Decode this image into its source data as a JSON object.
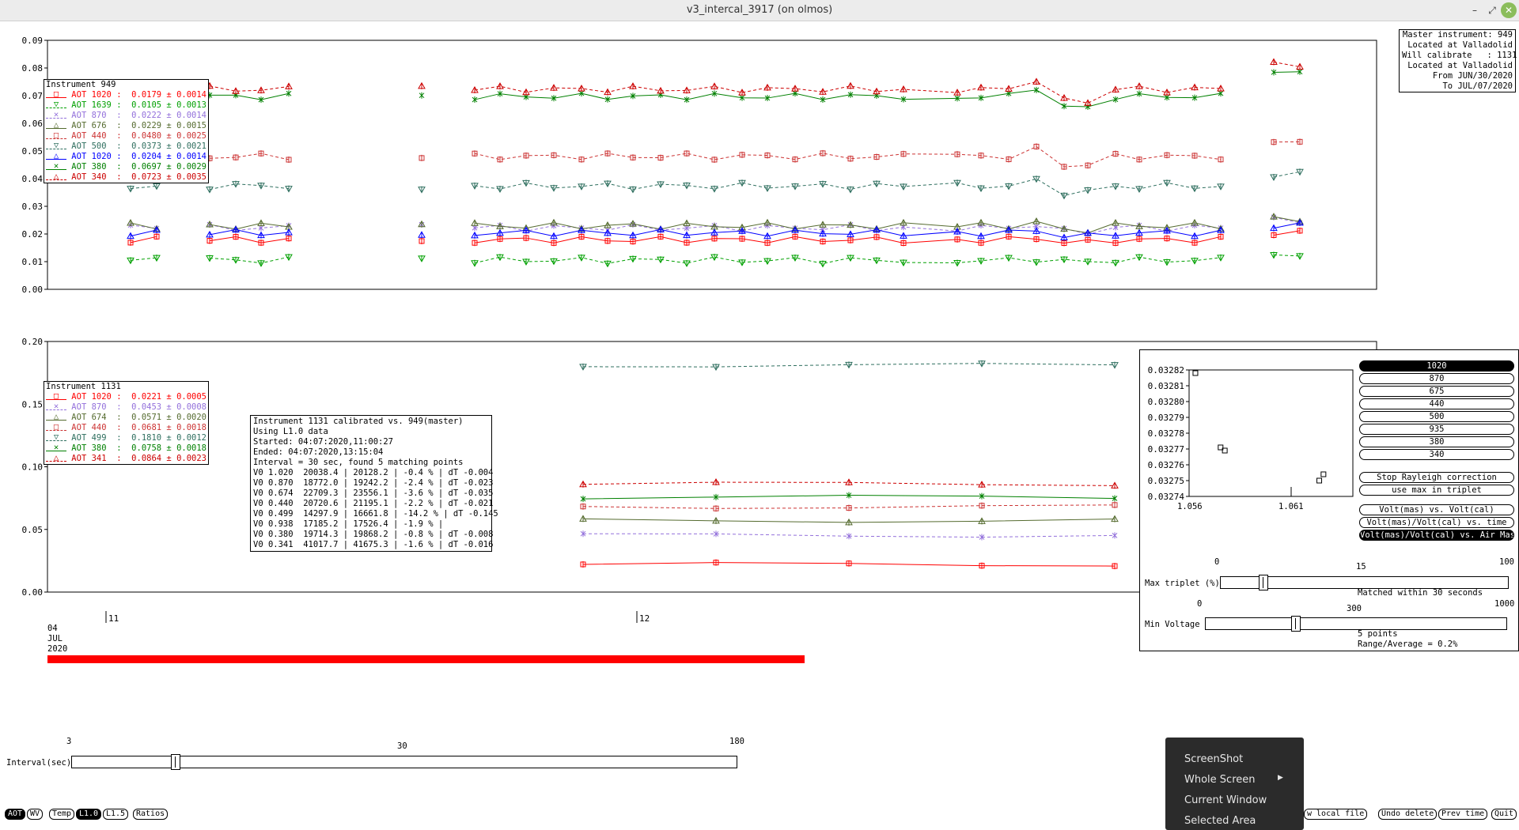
{
  "window": {
    "title": "v3_intercal_3917 (on olmos)"
  },
  "master_info": [
    "Master instrument: 949",
    "Located at Valladolid",
    "Will calibrate   : 1131",
    "Located at Valladolid",
    "From JUN/30/2020",
    "To JUL/07/2020"
  ],
  "top_plot": {
    "y_ticks": [
      "0.09",
      "0.08",
      "0.07",
      "0.06",
      "0.05",
      "0.04",
      "0.03",
      "0.02",
      "0.01",
      "0.00"
    ],
    "ylim": [
      0,
      0.09
    ]
  },
  "bottom_plot": {
    "y_ticks": [
      "0.20",
      "0.15",
      "0.10",
      "0.05",
      "0.00"
    ],
    "ylim": [
      0,
      0.2
    ]
  },
  "legend_949": {
    "header": "Instrument 949",
    "rows": [
      {
        "marker": "□",
        "label": "AOT 1020 :",
        "value": "0.0179 ± 0.0014",
        "color": "#ff0000",
        "dash": false
      },
      {
        "marker": "▽",
        "label": "AOT 1639 :",
        "value": "0.0105 ± 0.0013",
        "color": "#00a000",
        "dash": true
      },
      {
        "marker": "✕",
        "label": "AOT 870  :",
        "value": "0.0222 ± 0.0014",
        "color": "#9370db",
        "dash": true
      },
      {
        "marker": "△",
        "label": "AOT 676  :",
        "value": "0.0229 ± 0.0015",
        "color": "#556b2f",
        "dash": false
      },
      {
        "marker": "□",
        "label": "AOT 440  :",
        "value": "0.0480 ± 0.0025",
        "color": "#cc3333",
        "dash": true
      },
      {
        "marker": "▽",
        "label": "AOT 500  :",
        "value": "0.0373 ± 0.0021",
        "color": "#2f6f5f",
        "dash": true
      },
      {
        "marker": "△",
        "label": "AOT 1020 :",
        "value": "0.0204 ± 0.0014",
        "color": "#0000ff",
        "dash": false
      },
      {
        "marker": "✕",
        "label": "AOT 380  :",
        "value": "0.0697 ± 0.0029",
        "color": "#008000",
        "dash": false
      },
      {
        "marker": "△",
        "label": "AOT 340  :",
        "value": "0.0723 ± 0.0035",
        "color": "#cc0000",
        "dash": true
      }
    ]
  },
  "legend_1131": {
    "header": "Instrument 1131",
    "rows": [
      {
        "marker": "□",
        "label": "AOT 1020 :",
        "value": "0.0221 ± 0.0005",
        "color": "#ff0000",
        "dash": false
      },
      {
        "marker": "✕",
        "label": "AOT 870  :",
        "value": "0.0453 ± 0.0008",
        "color": "#9370db",
        "dash": true
      },
      {
        "marker": "△",
        "label": "AOT 674  :",
        "value": "0.0571 ± 0.0020",
        "color": "#556b2f",
        "dash": false
      },
      {
        "marker": "□",
        "label": "AOT 440  :",
        "value": "0.0681 ± 0.0018",
        "color": "#cc3333",
        "dash": true
      },
      {
        "marker": "▽",
        "label": "AOT 499  :",
        "value": "0.1810 ± 0.0012",
        "color": "#2f6f5f",
        "dash": true
      },
      {
        "marker": "✕",
        "label": "AOT 380  :",
        "value": "0.0758 ± 0.0018",
        "color": "#008000",
        "dash": false
      },
      {
        "marker": "△",
        "label": "AOT 341  :",
        "value": "0.0864 ± 0.0023",
        "color": "#cc0000",
        "dash": true
      }
    ]
  },
  "calibration_info": [
    "Instrument 1131 calibrated vs. 949(master)",
    "Using L1.0 data",
    "Started: 04:07:2020,11:00:27",
    "Ended: 04:07:2020,13:15:04",
    "Interval = 30 sec, found 5 matching points",
    "V0 1.020  20038.4 | 20128.2 | -0.4 % | dT -0.004",
    "V0 0.870  18772.0 | 19242.2 | -2.4 % | dT -0.023",
    "V0 0.674  22709.3 | 23556.1 | -3.6 % | dT -0.035",
    "V0 0.440  20720.6 | 21195.1 | -2.2 % | dT -0.021",
    "V0 0.499  14297.9 | 16661.8 | -14.2 % | dT -0.145",
    "V0 0.938  17185.2 | 17526.4 | -1.9 % |",
    "V0 0.380  19714.3 | 19868.2 | -0.8 % | dT -0.008",
    "V0 0.341  41017.7 | 41675.3 | -1.6 % | dT -0.016"
  ],
  "time_axis": {
    "tick_11": "11",
    "tick_12": "12",
    "date_day": "04",
    "date_month": "JUL",
    "date_year": "2020"
  },
  "scatter": {
    "y_ticks": [
      "0.03282",
      "0.03281",
      "0.03280",
      "0.03279",
      "0.03278",
      "0.03277",
      "0.03276",
      "0.03275",
      "0.03274"
    ],
    "x_ticks": [
      "1.056",
      "1.061"
    ],
    "points": [
      {
        "x": 1.056,
        "y": 0.032818
      },
      {
        "x": 1.0572,
        "y": 0.032771
      },
      {
        "x": 1.0574,
        "y": 0.032769
      },
      {
        "x": 1.0619,
        "y": 0.03275
      },
      {
        "x": 1.0621,
        "y": 0.032754
      }
    ],
    "xlim": [
      1.0557,
      1.0635
    ],
    "ylim": [
      0.03274,
      0.03282
    ]
  },
  "wavelength_buttons": [
    "1020",
    "870",
    "675",
    "440",
    "500",
    "935",
    "380",
    "340"
  ],
  "wavelength_selected": "1020",
  "option_buttons": [
    "Stop Rayleigh correction",
    "use max in triplet"
  ],
  "plot_mode_buttons": [
    "Volt(mas) vs. Volt(cal)",
    "Volt(mas)/Volt(cal) vs. time",
    "Volt(mas)/Volt(cal) vs. Air Mass"
  ],
  "plot_mode_selected": "Volt(mas)/Volt(cal) vs. Air Mass",
  "max_triplet": {
    "label": "Max triplet (%)",
    "min": "0",
    "mid": "15",
    "max": "100",
    "value": 3,
    "status": "Matched within 30 seconds"
  },
  "min_voltage": {
    "label": "Min Voltage",
    "min": "0",
    "mid": "300",
    "max": "1000",
    "value": 300,
    "status1": "5 points",
    "status2": "Range/Average = 0.2%"
  },
  "interval": {
    "label": "Interval(sec)",
    "min": "3",
    "mid": "30",
    "max": "180",
    "value": 30
  },
  "bottom_buttons": [
    "AOT",
    "WV",
    "Temp",
    "L1.0",
    "L1.5",
    "Ratios"
  ],
  "bottom_selected": [
    "AOT",
    "L1.0"
  ],
  "right_buttons": [
    "w local file",
    "Undo delete",
    "Prev time",
    "Quit"
  ],
  "context_menu": [
    "ScreenShot",
    "Whole Screen",
    "Current Window",
    "Selected Area"
  ]
}
